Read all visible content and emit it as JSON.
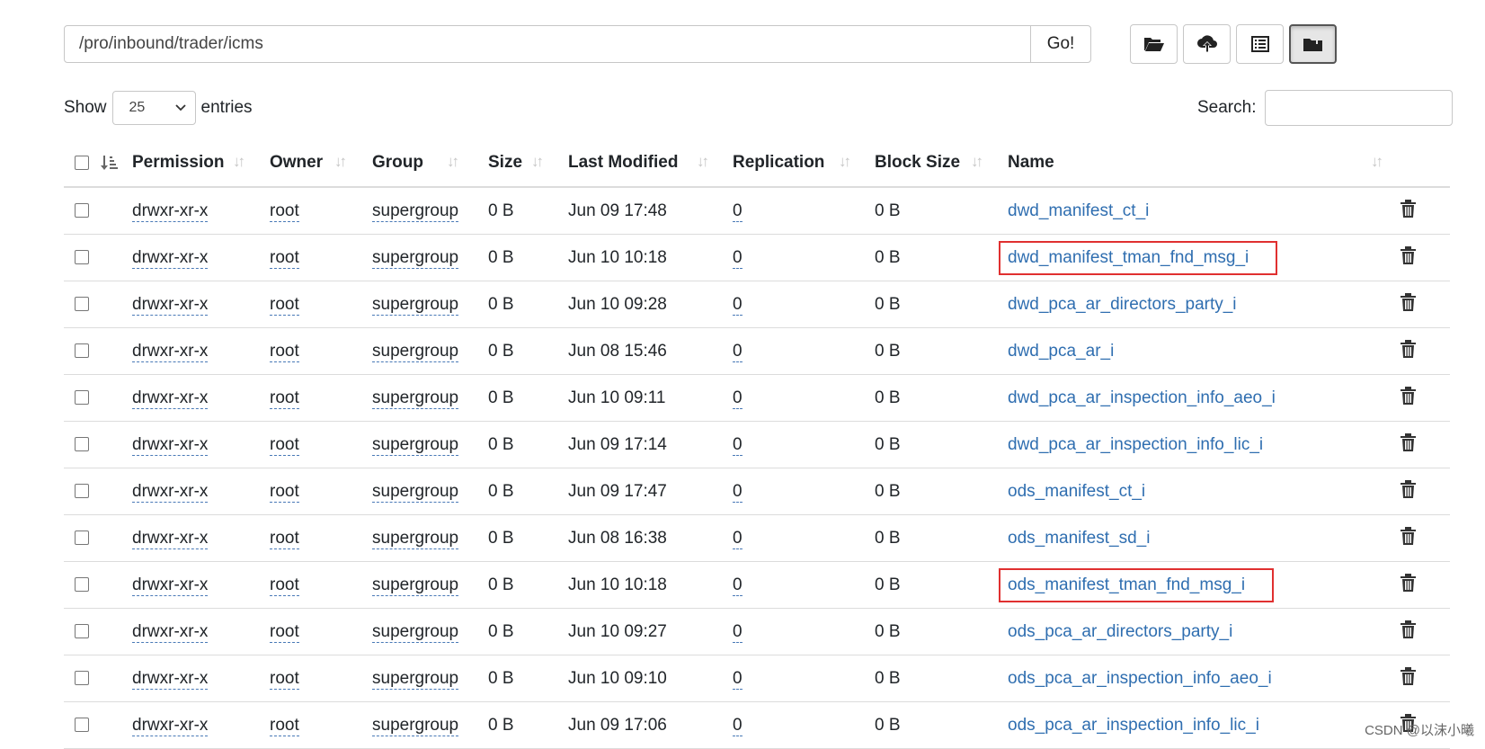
{
  "path": {
    "value": "/pro/inbound/trader/icms",
    "go_label": "Go!"
  },
  "toolbar": {
    "buttons": [
      {
        "icon": "folder-open-icon"
      },
      {
        "icon": "cloud-upload-icon"
      },
      {
        "icon": "list-icon"
      },
      {
        "icon": "folder-upload-icon",
        "active": true
      }
    ]
  },
  "show": {
    "label": "Show",
    "value": "25",
    "suffix": "entries"
  },
  "search": {
    "label": "Search:",
    "value": ""
  },
  "columns": [
    "Permission",
    "Owner",
    "Group",
    "Size",
    "Last Modified",
    "Replication",
    "Block Size",
    "Name"
  ],
  "rows": [
    {
      "permission": "drwxr-xr-x",
      "owner": "root",
      "group": "supergroup",
      "size": "0 B",
      "modified": "Jun 09 17:48",
      "replication": "0",
      "block": "0 B",
      "name": "dwd_manifest_ct_i",
      "highlight": false
    },
    {
      "permission": "drwxr-xr-x",
      "owner": "root",
      "group": "supergroup",
      "size": "0 B",
      "modified": "Jun 10 10:18",
      "replication": "0",
      "block": "0 B",
      "name": "dwd_manifest_tman_fnd_msg_i",
      "highlight": true
    },
    {
      "permission": "drwxr-xr-x",
      "owner": "root",
      "group": "supergroup",
      "size": "0 B",
      "modified": "Jun 10 09:28",
      "replication": "0",
      "block": "0 B",
      "name": "dwd_pca_ar_directors_party_i",
      "highlight": false
    },
    {
      "permission": "drwxr-xr-x",
      "owner": "root",
      "group": "supergroup",
      "size": "0 B",
      "modified": "Jun 08 15:46",
      "replication": "0",
      "block": "0 B",
      "name": "dwd_pca_ar_i",
      "highlight": false
    },
    {
      "permission": "drwxr-xr-x",
      "owner": "root",
      "group": "supergroup",
      "size": "0 B",
      "modified": "Jun 10 09:11",
      "replication": "0",
      "block": "0 B",
      "name": "dwd_pca_ar_inspection_info_aeo_i",
      "highlight": false
    },
    {
      "permission": "drwxr-xr-x",
      "owner": "root",
      "group": "supergroup",
      "size": "0 B",
      "modified": "Jun 09 17:14",
      "replication": "0",
      "block": "0 B",
      "name": "dwd_pca_ar_inspection_info_lic_i",
      "highlight": false
    },
    {
      "permission": "drwxr-xr-x",
      "owner": "root",
      "group": "supergroup",
      "size": "0 B",
      "modified": "Jun 09 17:47",
      "replication": "0",
      "block": "0 B",
      "name": "ods_manifest_ct_i",
      "highlight": false
    },
    {
      "permission": "drwxr-xr-x",
      "owner": "root",
      "group": "supergroup",
      "size": "0 B",
      "modified": "Jun 08 16:38",
      "replication": "0",
      "block": "0 B",
      "name": "ods_manifest_sd_i",
      "highlight": false
    },
    {
      "permission": "drwxr-xr-x",
      "owner": "root",
      "group": "supergroup",
      "size": "0 B",
      "modified": "Jun 10 10:18",
      "replication": "0",
      "block": "0 B",
      "name": "ods_manifest_tman_fnd_msg_i",
      "highlight": true
    },
    {
      "permission": "drwxr-xr-x",
      "owner": "root",
      "group": "supergroup",
      "size": "0 B",
      "modified": "Jun 10 09:27",
      "replication": "0",
      "block": "0 B",
      "name": "ods_pca_ar_directors_party_i",
      "highlight": false
    },
    {
      "permission": "drwxr-xr-x",
      "owner": "root",
      "group": "supergroup",
      "size": "0 B",
      "modified": "Jun 10 09:10",
      "replication": "0",
      "block": "0 B",
      "name": "ods_pca_ar_inspection_info_aeo_i",
      "highlight": false
    },
    {
      "permission": "drwxr-xr-x",
      "owner": "root",
      "group": "supergroup",
      "size": "0 B",
      "modified": "Jun 09 17:06",
      "replication": "0",
      "block": "0 B",
      "name": "ods_pca_ar_inspection_info_lic_i",
      "highlight": false
    }
  ],
  "watermark": "CSDN @以沫小曦",
  "colors": {
    "link": "#2f6eb0",
    "highlight": "#e03030"
  }
}
